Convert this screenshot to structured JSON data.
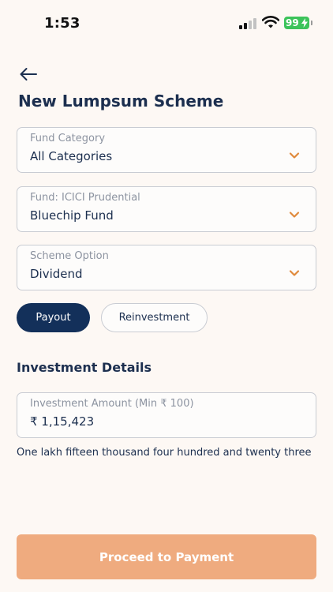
{
  "status_bar": {
    "time": "1:53",
    "battery": "99"
  },
  "header": {
    "title": "New Lumpsum Scheme"
  },
  "fields": {
    "fund_category": {
      "label": "Fund Category",
      "value": "All Categories"
    },
    "fund": {
      "label": "Fund: ICICI Prudential",
      "value": "Bluechip Fund"
    },
    "scheme_option": {
      "label": "Scheme Option",
      "value": "Dividend"
    }
  },
  "dividend_options": {
    "payout": "Payout",
    "reinvestment": "Reinvestment",
    "selected": "Payout"
  },
  "investment": {
    "section_title": "Investment Details",
    "amount_label": "Investment Amount (Min ₹ 100)",
    "amount_value": "₹ 1,15,423",
    "amount_words": "One lakh fifteen thousand four hundred and twenty three"
  },
  "footer": {
    "proceed_label": "Proceed to Payment"
  },
  "colors": {
    "primary": "#13305a",
    "accent": "#e08a3c",
    "cta": "#efab7f",
    "background": "#fdf8f4",
    "battery": "#3cc35a"
  }
}
